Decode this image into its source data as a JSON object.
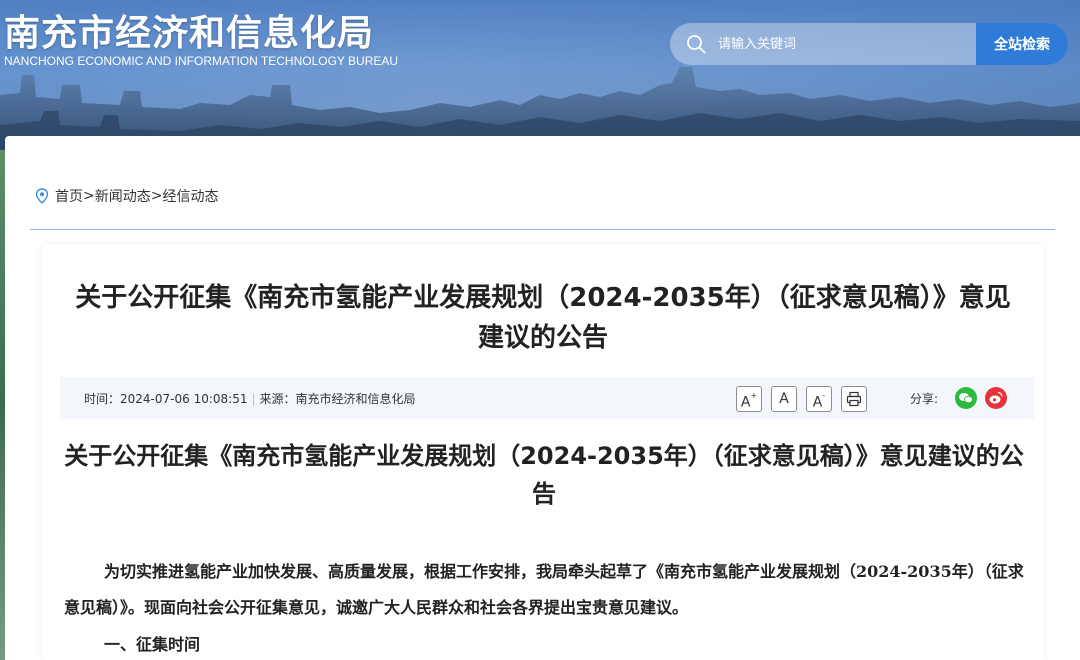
{
  "header": {
    "site_title": "南充市经济和信息化局",
    "site_subtitle": "NANCHONG ECONOMIC AND INFORMATION TECHNOLOGY BUREAU",
    "search_placeholder": "请输入关键词",
    "search_button": "全站检索",
    "accent_color": "#2f7bd8"
  },
  "breadcrumb": {
    "icon": "location-pin-icon",
    "items": [
      "首页",
      "新闻动态",
      "经信动态"
    ],
    "separator": ">"
  },
  "article": {
    "title": "关于公开征集《南充市氢能产业发展规划（2024-2035年）（征求意见稿）》意见建议的公告",
    "meta": {
      "time_label": "时间：",
      "time_value": "2024-07-06 10:08:51",
      "divider": "|",
      "source_label": "来源：",
      "source_value": "南充市经济和信息化局"
    },
    "tools": {
      "font_increase": "A",
      "font_normal": "A",
      "font_decrease": "A",
      "print_icon": "printer-icon"
    },
    "share": {
      "label": "分享:",
      "wechat_icon": "wechat-icon",
      "weibo_icon": "weibo-icon"
    },
    "body_heading": "关于公开征集《南充市氢能产业发展规划（2024-2035年）（征求意见稿）》意见建议的公告",
    "paragraph_1": "为切实推进氢能产业加快发展、高质量发展，根据工作安排，我局牵头起草了《南充市氢能产业发展规划（2024-2035年）（征求意见稿）》。现面向社会公开征集意见，诚邀广大人民群众和社会各界提出宝贵意见建议。",
    "section_1": "一、征集时间"
  }
}
